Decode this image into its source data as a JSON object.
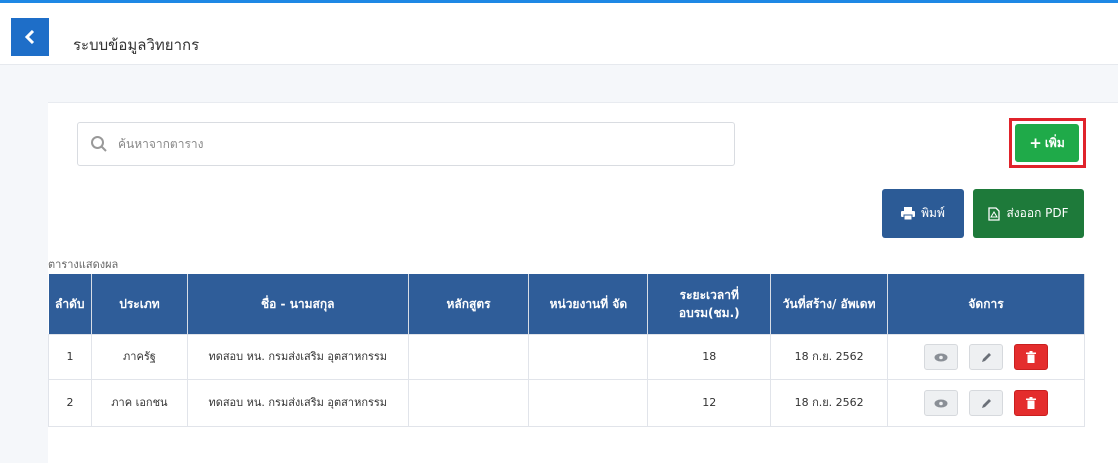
{
  "header": {
    "title": "ระบบข้อมูลวิทยากร"
  },
  "search": {
    "placeholder": "ค้นหาจากตาราง",
    "value": ""
  },
  "toolbar": {
    "add_label": "เพิ่ม",
    "print_label": "พิมพ์",
    "pdf_label": "ส่งออก PDF"
  },
  "table": {
    "caption": "ตารางแสดงผล",
    "headers": [
      "ลำดับ",
      "ประเภท",
      "ชื่อ - นามสกุล",
      "หลักสูตร",
      "หน่วยงานที่ จัด",
      "ระยะเวลาที่ อบรม(ชม.)",
      "วันที่สร้าง/ อัพเดท",
      "จัดการ"
    ],
    "rows": [
      {
        "no": "1",
        "type": "ภาครัฐ",
        "name": "ทดสอบ หน. กรมส่งเสริม อุตสาหกรรม",
        "course": "",
        "org": "",
        "hours": "18",
        "date": "18 ก.ย. 2562"
      },
      {
        "no": "2",
        "type": "ภาค เอกชน",
        "name": "ทดสอบ หน. กรมส่งเสริม อุตสาหกรรม",
        "course": "",
        "org": "",
        "hours": "12",
        "date": "18 ก.ย. 2562"
      }
    ]
  },
  "colors": {
    "accent": "#1e88e5",
    "header_bg": "#2f5d99",
    "add": "#1faa49",
    "pdf": "#1e7a3a",
    "print": "#2c5b96",
    "delete": "#e42d2d",
    "highlight": "#e0232b"
  },
  "icons": {
    "back": "chevron-left-icon",
    "search": "search-icon",
    "add": "plus-icon",
    "print": "printer-icon",
    "pdf": "file-pdf-icon",
    "view": "eye-icon",
    "edit": "pencil-icon",
    "delete": "trash-icon"
  }
}
